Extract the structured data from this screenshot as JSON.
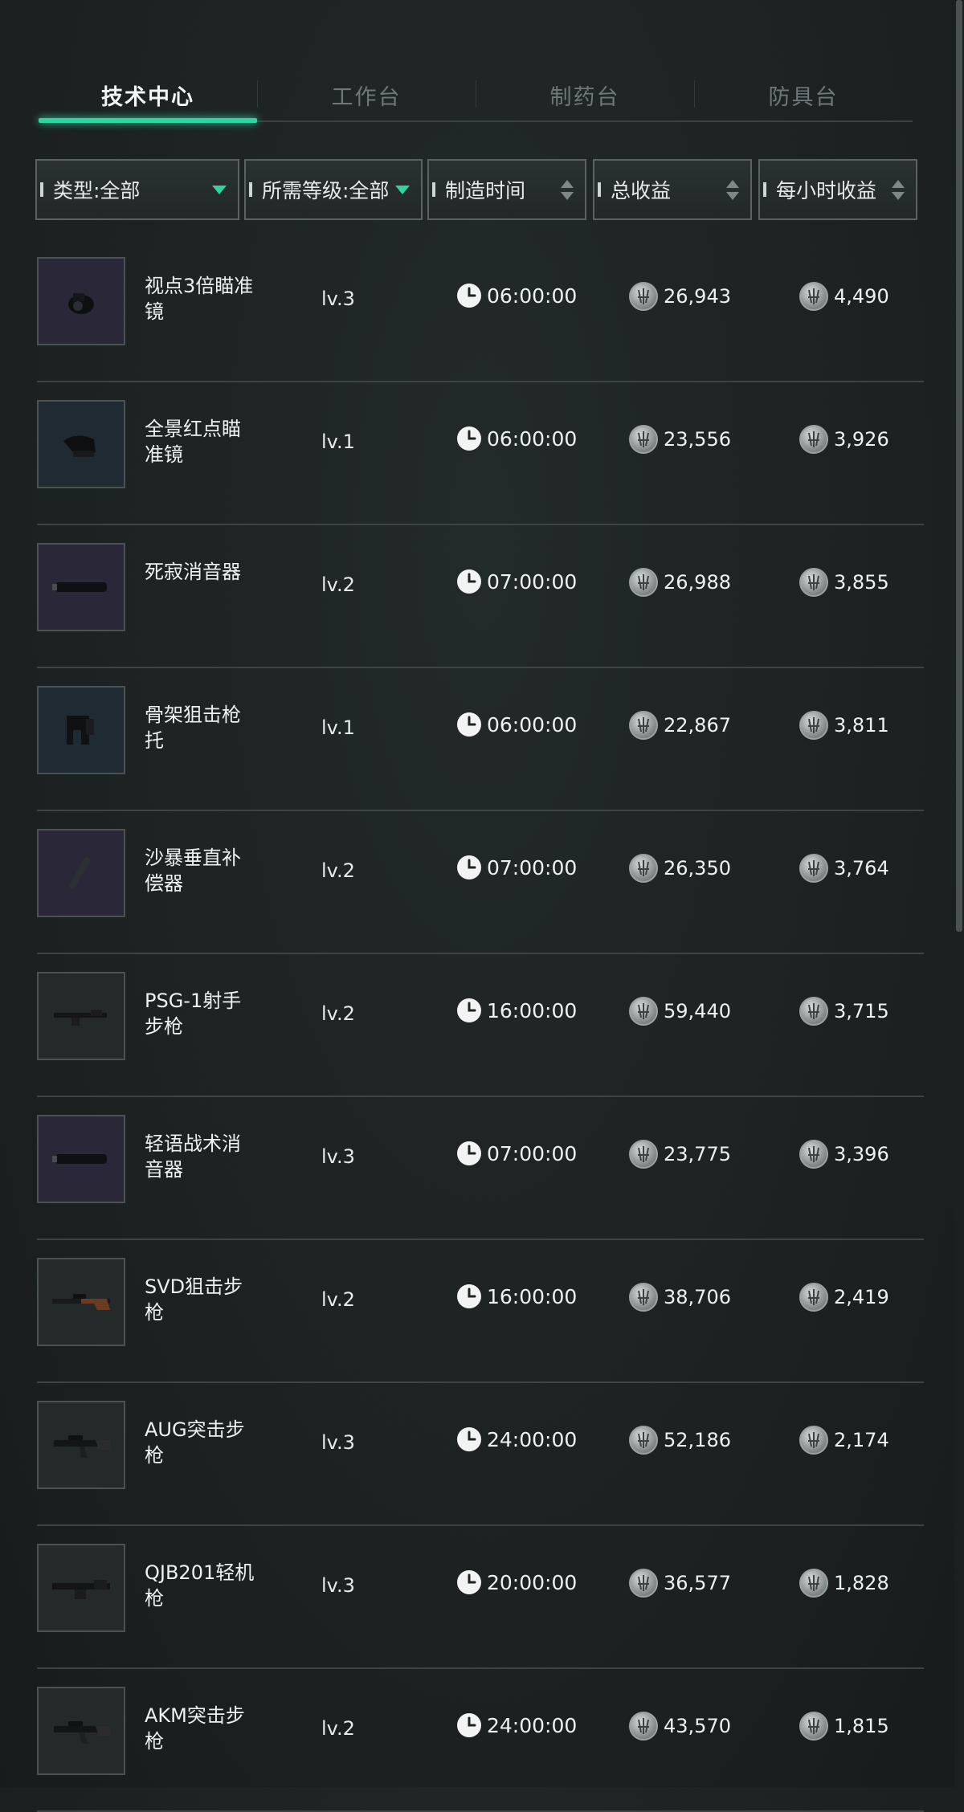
{
  "tabs": [
    {
      "label": "技术中心",
      "active": true
    },
    {
      "label": "工作台",
      "active": false
    },
    {
      "label": "制药台",
      "active": false
    },
    {
      "label": "防具台",
      "active": false
    }
  ],
  "filters": {
    "type": "类型:全部",
    "level": "所需等级:全部",
    "time": "制造时间",
    "total": "总收益",
    "hourly": "每小时收益"
  },
  "colors": {
    "accent": "#2fd4a0",
    "background": "#1d2222"
  },
  "rows": [
    {
      "name": "视点3倍瞄准镜",
      "level": "lv.3",
      "time": "06:00:00",
      "total": "26,943",
      "hourly": "4,490",
      "icon": "scope-icon",
      "tier": "purple"
    },
    {
      "name": "全景红点瞄准镜",
      "level": "lv.1",
      "time": "06:00:00",
      "total": "23,556",
      "hourly": "3,926",
      "icon": "red-dot-sight-icon",
      "tier": "blue"
    },
    {
      "name": "死寂消音器",
      "level": "lv.2",
      "time": "07:00:00",
      "total": "26,988",
      "hourly": "3,855",
      "icon": "suppressor-icon",
      "tier": "purple"
    },
    {
      "name": "骨架狙击枪托",
      "level": "lv.1",
      "time": "06:00:00",
      "total": "22,867",
      "hourly": "3,811",
      "icon": "stock-icon",
      "tier": "blue"
    },
    {
      "name": "沙暴垂直补偿器",
      "level": "lv.2",
      "time": "07:00:00",
      "total": "26,350",
      "hourly": "3,764",
      "icon": "compensator-icon",
      "tier": "purple"
    },
    {
      "name": "PSG-1射手步枪",
      "level": "lv.2",
      "time": "16:00:00",
      "total": "59,440",
      "hourly": "3,715",
      "icon": "rifle-icon",
      "tier": "gray"
    },
    {
      "name": "轻语战术消音器",
      "level": "lv.3",
      "time": "07:00:00",
      "total": "23,775",
      "hourly": "3,396",
      "icon": "suppressor-icon",
      "tier": "purple"
    },
    {
      "name": "SVD狙击步枪",
      "level": "lv.2",
      "time": "16:00:00",
      "total": "38,706",
      "hourly": "2,419",
      "icon": "sniper-rifle-icon",
      "tier": "gray"
    },
    {
      "name": "AUG突击步枪",
      "level": "lv.3",
      "time": "24:00:00",
      "total": "52,186",
      "hourly": "2,174",
      "icon": "assault-rifle-icon",
      "tier": "gray"
    },
    {
      "name": "QJB201轻机枪",
      "level": "lv.3",
      "time": "20:00:00",
      "total": "36,577",
      "hourly": "1,828",
      "icon": "machine-gun-icon",
      "tier": "gray"
    },
    {
      "name": "AKM突击步枪",
      "level": "lv.2",
      "time": "24:00:00",
      "total": "43,570",
      "hourly": "1,815",
      "icon": "assault-rifle-icon",
      "tier": "gray"
    }
  ]
}
